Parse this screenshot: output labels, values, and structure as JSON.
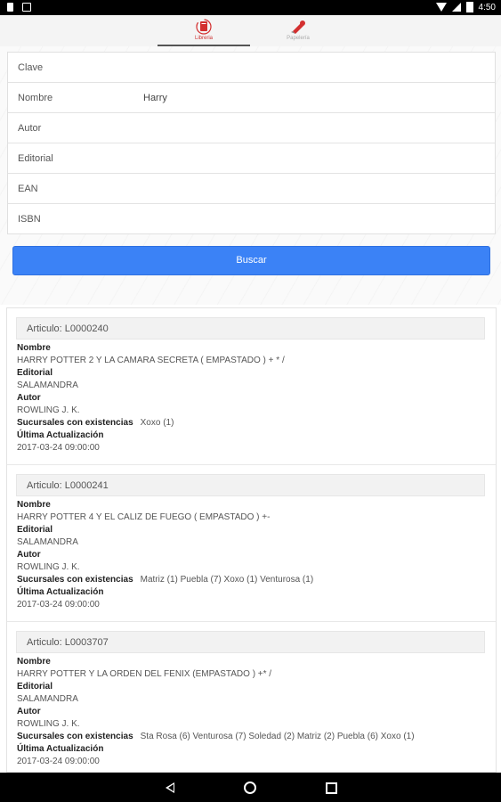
{
  "status_bar": {
    "time": "4:50"
  },
  "tabs": [
    {
      "label": "Libreria"
    },
    {
      "label": "Papelería"
    }
  ],
  "form": {
    "fields": [
      {
        "label": "Clave",
        "value": ""
      },
      {
        "label": "Nombre",
        "value": "Harry"
      },
      {
        "label": "Autor",
        "value": ""
      },
      {
        "label": "Editorial",
        "value": ""
      },
      {
        "label": "EAN",
        "value": ""
      },
      {
        "label": "ISBN",
        "value": ""
      }
    ],
    "search_button": "Buscar"
  },
  "labels": {
    "nombre": "Nombre",
    "editorial": "Editorial",
    "autor": "Autor",
    "sucursales": "Sucursales con existencias",
    "actualizacion": "Última Actualización"
  },
  "results": [
    {
      "header": "Articulo: L0000240",
      "nombre": "HARRY POTTER 2 Y LA CAMARA SECRETA ( EMPASTADO ) + * /",
      "editorial": "SALAMANDRA",
      "autor": "ROWLING J. K.",
      "sucursales": "Xoxo (1)",
      "actualizacion": "2017-03-24 09:00:00"
    },
    {
      "header": "Articulo: L0000241",
      "nombre": "HARRY POTTER 4 Y EL CALIZ DE FUEGO ( EMPASTADO ) +-",
      "editorial": "SALAMANDRA",
      "autor": "ROWLING J. K.",
      "sucursales": "Matriz (1) Puebla (7) Xoxo (1) Venturosa (1)",
      "actualizacion": "2017-03-24 09:00:00"
    },
    {
      "header": "Articulo: L0003707",
      "nombre": "HARRY POTTER Y LA ORDEN DEL FENIX (EMPASTADO ) +* /",
      "editorial": "SALAMANDRA",
      "autor": "ROWLING J. K.",
      "sucursales": "Sta Rosa (6) Venturosa (7) Soledad (2) Matriz (2) Puebla (6) Xoxo (1)",
      "actualizacion": "2017-03-24 09:00:00"
    }
  ],
  "colors": {
    "accent": "#3b82f6",
    "tab_icon": "#d32f2f"
  }
}
